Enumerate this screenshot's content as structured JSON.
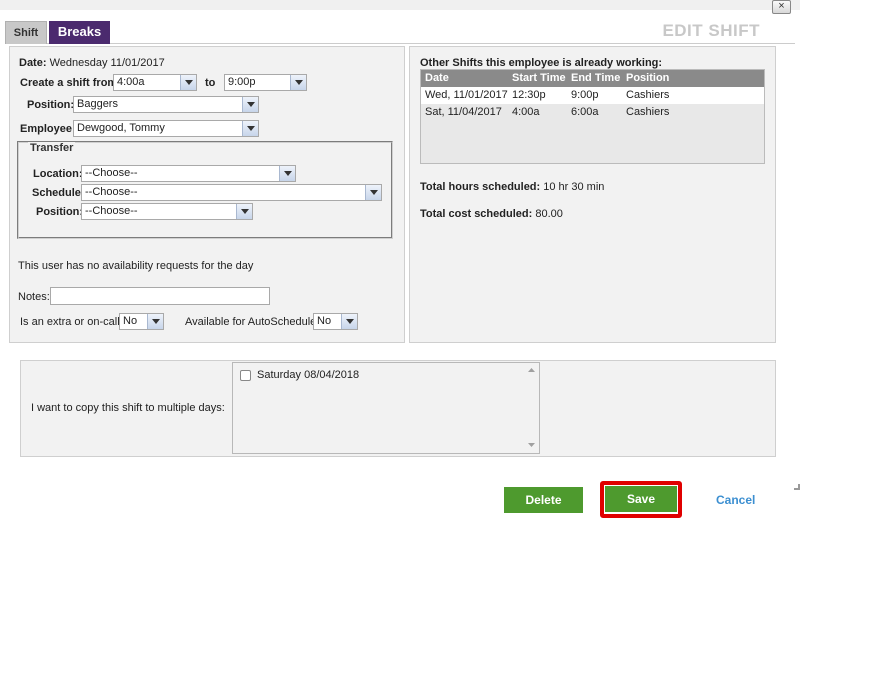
{
  "dialog": {
    "close_label": "×",
    "title": "EDIT SHIFT"
  },
  "tabs": [
    {
      "label": "Shift",
      "active": true
    },
    {
      "label": "Breaks",
      "active": false
    }
  ],
  "form": {
    "date_label": "Date:",
    "date_value": "Wednesday 11/01/2017",
    "create_from_label": "Create a shift from",
    "start_time": "4:00a",
    "to_label": "to",
    "end_time": "9:00p",
    "position_label": "Position:",
    "position_value": "Baggers",
    "employee_label": "Employee:",
    "employee_value": "Dewgood, Tommy",
    "transfer": {
      "legend": "Transfer",
      "location_label": "Location:",
      "location_value": "--Choose--",
      "schedule_label": "Schedule:",
      "schedule_value": "--Choose--",
      "position_label": "Position:",
      "position_value": "--Choose--"
    },
    "availability_note": "This user has no availability requests for the day",
    "notes_label": "Notes:",
    "notes_value": "",
    "extra_oncall_label": "Is an extra or on-call?",
    "extra_oncall_value": "No",
    "autoschedule_label": "Available for AutoSchedule:",
    "autoschedule_value": "No"
  },
  "other_shifts": {
    "heading": "Other Shifts this employee is already working:",
    "columns": [
      "Date",
      "Start Time",
      "End Time",
      "Position"
    ],
    "rows": [
      [
        "Wed, 11/01/2017",
        "12:30p",
        "9:00p",
        "Cashiers"
      ],
      [
        "Sat, 11/04/2017",
        "4:00a",
        "6:00a",
        "Cashiers"
      ]
    ],
    "total_hours_label": "Total hours scheduled:",
    "total_hours_value": "10 hr 30 min",
    "total_cost_label": "Total cost scheduled:",
    "total_cost_value": "80.00"
  },
  "copy": {
    "label": "I want to copy this shift to multiple days:",
    "days": [
      {
        "label": "Saturday 08/04/2018",
        "checked": false
      }
    ]
  },
  "actions": {
    "delete_label": "Delete",
    "save_label": "Save",
    "cancel_label": "Cancel"
  },
  "colors": {
    "breaks_tab": "#4b2a6e",
    "button_green": "#4e9a2e",
    "highlight_red": "#e00000",
    "cancel_blue": "#3c8fd1"
  }
}
